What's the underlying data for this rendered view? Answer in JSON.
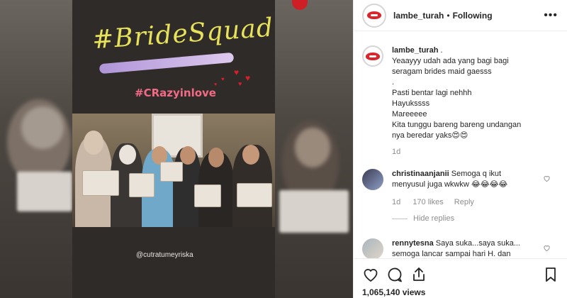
{
  "story": {
    "title": "#BrideSquad",
    "tag": "#CRazyinlove",
    "mention": "@cutratumeyriska"
  },
  "header": {
    "username": "lambe_turah",
    "separator": "•",
    "follow_status": "Following",
    "more_icon": "more-horizontal-icon"
  },
  "caption": {
    "username": "lambe_turah",
    "text_lines": [
      ".",
      "Yeaayyy udah ada yang bagi bagi",
      "seragam brides maid gaesss",
      ".",
      "Pasti bentar lagi nehhh",
      "Hayukssss",
      "Mareeeee",
      "Kita tunggu bareng bareng undangan",
      "nya beredar yaks😍😍"
    ],
    "time": "1d"
  },
  "comments": [
    {
      "username": "christinaanjanii",
      "text": "Semoga q ikut menyusul juga wkwkw 😂😂😂😂",
      "time": "1d",
      "likes": "170 likes",
      "reply": "Reply",
      "hide_replies": "Hide replies"
    },
    {
      "username": "rennytesna",
      "text": "Saya suka...saya suka... semoga lancar sampai hari H. dan"
    }
  ],
  "actions": {
    "icons": [
      "heart-icon",
      "comment-icon",
      "share-icon",
      "bookmark-icon"
    ],
    "views": "1,065,140 views"
  },
  "colors": {
    "title_yellow": "#e7e25a",
    "tag_pink": "#f26a86",
    "brand_red": "#d7262c",
    "text": "#262626",
    "muted": "#8e8e8e"
  }
}
